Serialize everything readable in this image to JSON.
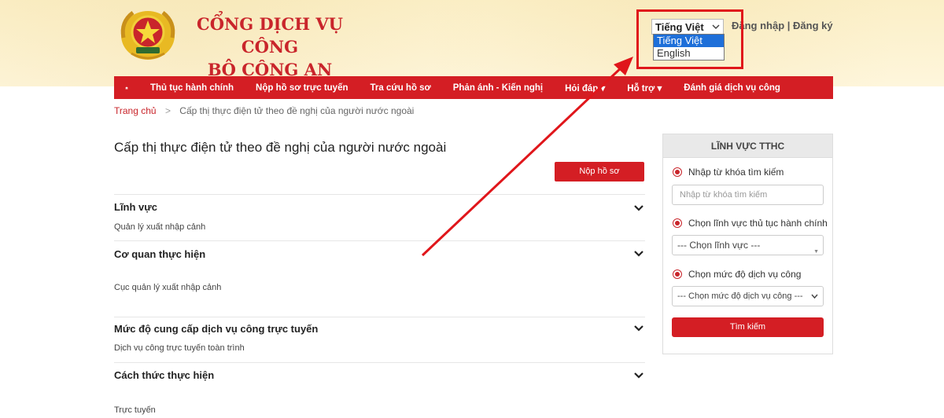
{
  "header": {
    "title_line1": "CỔNG DỊCH VỤ CÔNG",
    "title_line2": "BỘ CÔNG AN",
    "language_selected": "Tiếng Việt",
    "language_options": [
      "Tiếng Việt",
      "English"
    ],
    "auth_links": "Đăng nhập | Đăng ký"
  },
  "nav": {
    "home_icon": "home-icon",
    "items": [
      "Thủ tục hành chính",
      "Nộp hồ sơ trực tuyến",
      "Tra cứu hồ sơ",
      "Phản ánh - Kiến nghị",
      "Hỏi đáp",
      "Hỗ trợ",
      "Đánh giá dịch vụ công"
    ],
    "dropdown_marker": "▾"
  },
  "breadcrumb": {
    "home": "Trang chủ",
    "separator": ">",
    "current": "Cấp thị thực điện tử theo đề nghị của người nước ngoài"
  },
  "main": {
    "title": "Cấp thị thực điện tử theo đề nghị của người nước ngoài",
    "submit_label": "Nộp hồ sơ",
    "sections": [
      {
        "title": "Lĩnh vực",
        "value": "Quản lý xuất nhập cảnh"
      },
      {
        "title": "Cơ quan thực hiện",
        "value": "Cục quản lý xuất nhập cảnh"
      },
      {
        "title": "Mức độ cung cấp dịch vụ công trực tuyến",
        "value": "Dịch vụ công trực tuyến toàn trình"
      },
      {
        "title": "Cách thức thực hiện",
        "value": "Trực tuyến"
      }
    ]
  },
  "sidebar": {
    "heading": "LĨNH VỰC TTHC",
    "radio_keyword": "Nhập từ khóa tìm kiếm",
    "keyword_placeholder": "Nhập từ khóa tìm kiếm",
    "radio_field": "Chọn lĩnh vực thủ tục hành chính",
    "field_select": "--- Chọn lĩnh vực ---",
    "radio_level": "Chọn mức độ dịch vụ công",
    "level_select": "--- Chọn mức độ dịch vụ công ---",
    "search_label": "Tìm kiếm"
  },
  "colors": {
    "brand_red": "#d41e24",
    "annotation_red": "#e0161b",
    "header_bg": "#fbefc7"
  }
}
